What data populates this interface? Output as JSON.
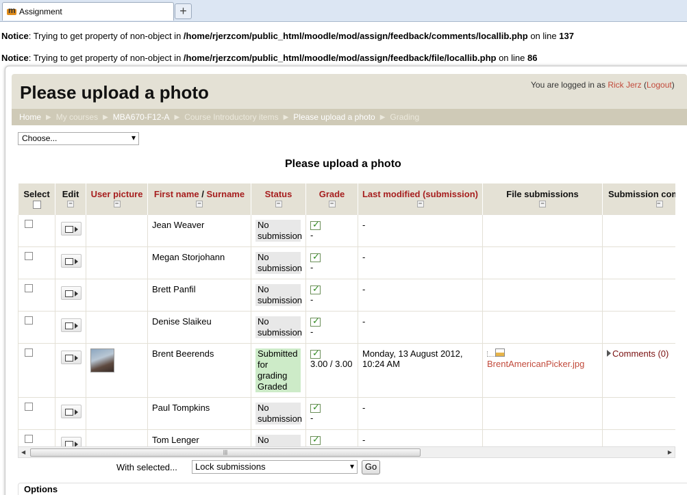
{
  "browser": {
    "tab_title": "Assignment",
    "new_tab": "+"
  },
  "notices": [
    {
      "label": "Notice",
      "pre": ": Trying to get property of non-object in ",
      "path": "/home/rjerzcom/public_html/moodle/mod/assign/feedback/comments/locallib.php",
      "mid": " on line ",
      "line": "137"
    },
    {
      "label": "Notice",
      "pre": ": Trying to get property of non-object in ",
      "path": "/home/rjerzcom/public_html/moodle/mod/assign/feedback/file/locallib.php",
      "mid": " on line ",
      "line": "86"
    }
  ],
  "header": {
    "title": "Please upload a photo",
    "login_prefix": "You are logged in as ",
    "user_name": "Rick Jerz",
    "open_paren": " (",
    "logout": "Logout",
    "close_paren": ")"
  },
  "breadcrumb": {
    "items": [
      "Home",
      "My courses",
      "MBA670-F12-A",
      "Course Introductory items",
      "Please upload a photo",
      "Grading"
    ],
    "separator": "▶"
  },
  "jump_select": {
    "value": "Choose..."
  },
  "grading": {
    "title": "Please upload a photo",
    "columns": {
      "select": "Select",
      "edit": "Edit",
      "picture": "User picture",
      "first_name": "First name",
      "slash": " / ",
      "surname": "Surname",
      "status": "Status",
      "grade": "Grade",
      "last_modified": "Last modified (submission)",
      "file_submissions": "File submissions",
      "submission_comments": "Submission comments"
    },
    "collapse_glyph": "−",
    "rows": [
      {
        "name": "Jean Weaver",
        "status": "No submission",
        "grade": "-",
        "modified": "-"
      },
      {
        "name": "Megan Storjohann",
        "status": "No submission",
        "grade": "-",
        "modified": "-"
      },
      {
        "name": "Brett Panfil",
        "status": "No submission",
        "grade": "-",
        "modified": "-"
      },
      {
        "name": "Denise Slaikeu",
        "status": "No submission",
        "grade": "-",
        "modified": "-"
      },
      {
        "name": "Brent Beerends",
        "status": "Submitted for grading Graded",
        "grade": "3.00 / 3.00",
        "modified": "Monday, 13 August 2012, 10:24 AM",
        "file": "BrentAmericanPicker.jpg",
        "comments": "Comments (0)"
      },
      {
        "name": "Paul Tompkins",
        "status": "No submission",
        "grade": "-",
        "modified": "-"
      },
      {
        "name": "Tom Lenger",
        "status": "No submission",
        "grade": "-",
        "modified": "-"
      }
    ]
  },
  "scrollbar": {
    "left": "◀",
    "right": "▶",
    "grip": "|||"
  },
  "bulk": {
    "label": "With selected...",
    "action": "Lock submissions",
    "go": "Go"
  },
  "options": {
    "label": "Options"
  }
}
